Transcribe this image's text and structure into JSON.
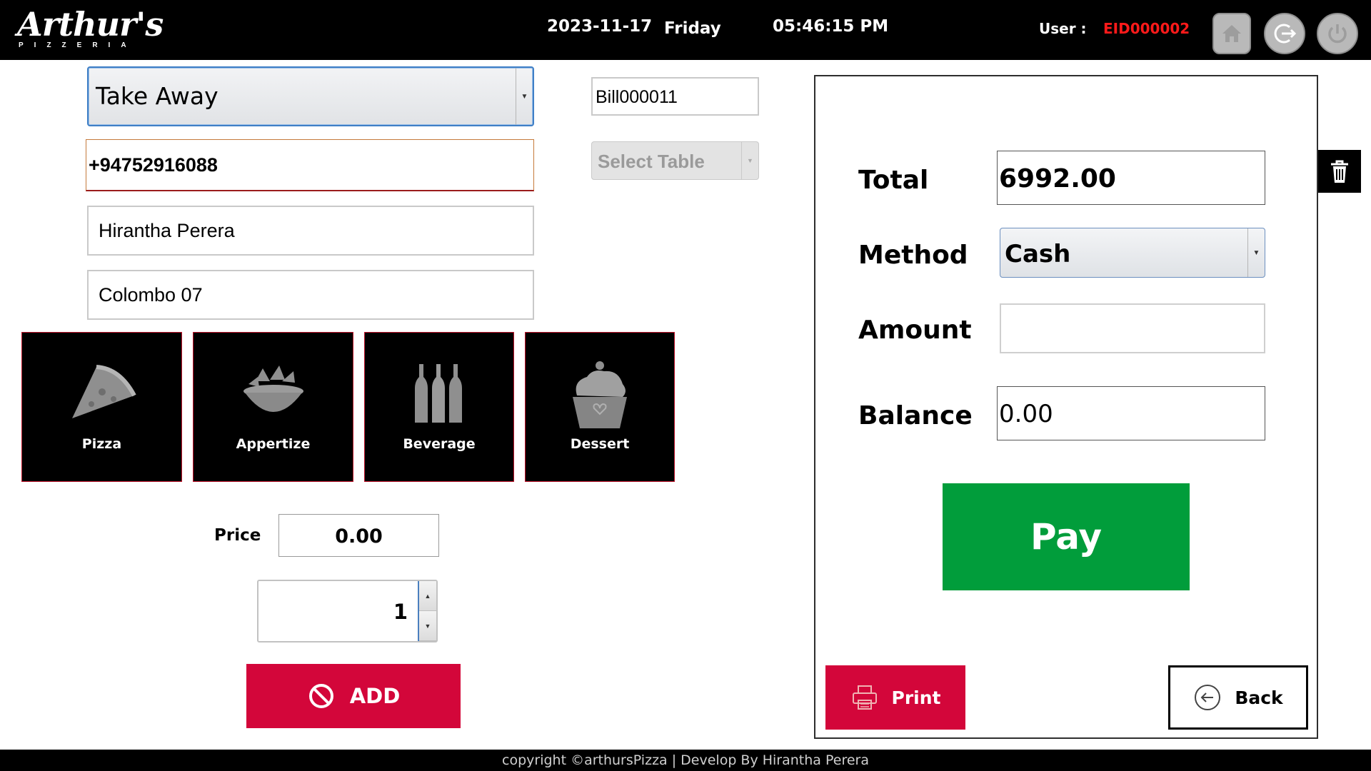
{
  "header": {
    "logo_main": "Arthur's",
    "logo_sub": "PIZZERIA",
    "date": "2023-11-17",
    "day": "Friday",
    "time": "05:46:15 PM",
    "user_label": "User :",
    "user_id": "EID000002",
    "buttons": [
      "home-icon",
      "logout-icon",
      "power-icon"
    ]
  },
  "order": {
    "order_type": "Take Away",
    "phone": "+94752916088",
    "customer_name": "Hirantha Perera",
    "address": "Colombo 07",
    "bill_no": "Bill000011",
    "table_placeholder": "Select Table"
  },
  "categories": [
    {
      "label": "Pizza",
      "icon": "pizza-icon"
    },
    {
      "label": "Appertize",
      "icon": "appetizer-bowl-icon"
    },
    {
      "label": "Beverage",
      "icon": "bottles-icon"
    },
    {
      "label": "Dessert",
      "icon": "cupcake-icon"
    }
  ],
  "item": {
    "price_label": "Price",
    "price": "0.00",
    "quantity": "1",
    "add_label": "ADD"
  },
  "payment": {
    "total_label": "Total",
    "total": "6992.00",
    "method_label": "Method",
    "method": "Cash",
    "amount_label": "Amount",
    "amount": "",
    "balance_label": "Balance",
    "balance": "0.00",
    "pay_label": "Pay",
    "print_label": "Print",
    "back_label": "Back"
  },
  "footer": {
    "text": "copyright ©arthursPizza | Develop By Hirantha Perera"
  },
  "colors": {
    "brand_red": "#d3063a",
    "pay_green": "#019d3b",
    "user_id_red": "#ff1a1a"
  }
}
